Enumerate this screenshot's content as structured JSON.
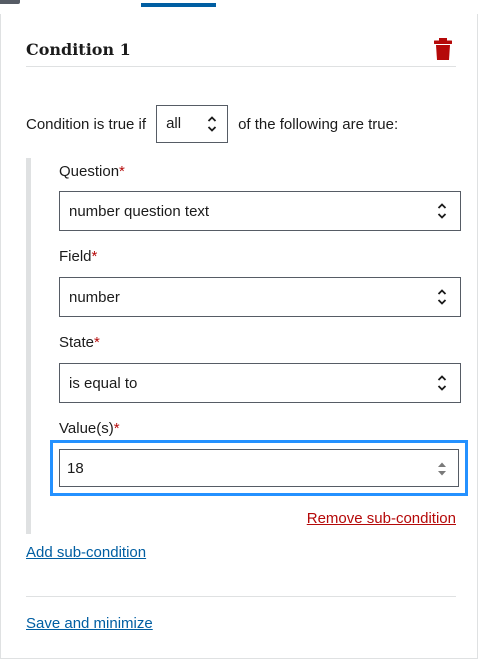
{
  "condition": {
    "title": "Condition 1",
    "sentence_prefix": "Condition is true if",
    "match_mode": "all",
    "sentence_suffix": "of the following are true:"
  },
  "subcondition": {
    "question": {
      "label": "Question",
      "value": "number question text"
    },
    "field": {
      "label": "Field",
      "value": "number"
    },
    "state": {
      "label": "State",
      "value": "is equal to"
    },
    "values": {
      "label": "Value(s)",
      "value": "18"
    },
    "required_marker": "*",
    "remove_label": "Remove sub-condition"
  },
  "actions": {
    "add_subcondition_label": "Add sub-condition",
    "save_minimize_label": "Save and minimize"
  },
  "colors": {
    "link": "#005ea2",
    "danger": "#b50909",
    "focus": "#2491ff",
    "border": "#565c65",
    "divider": "#dfe1e2"
  },
  "icons": {
    "delete": "trash-icon",
    "select": "chevron-updown-icon",
    "number_spinner": "spinner-arrows-icon"
  }
}
